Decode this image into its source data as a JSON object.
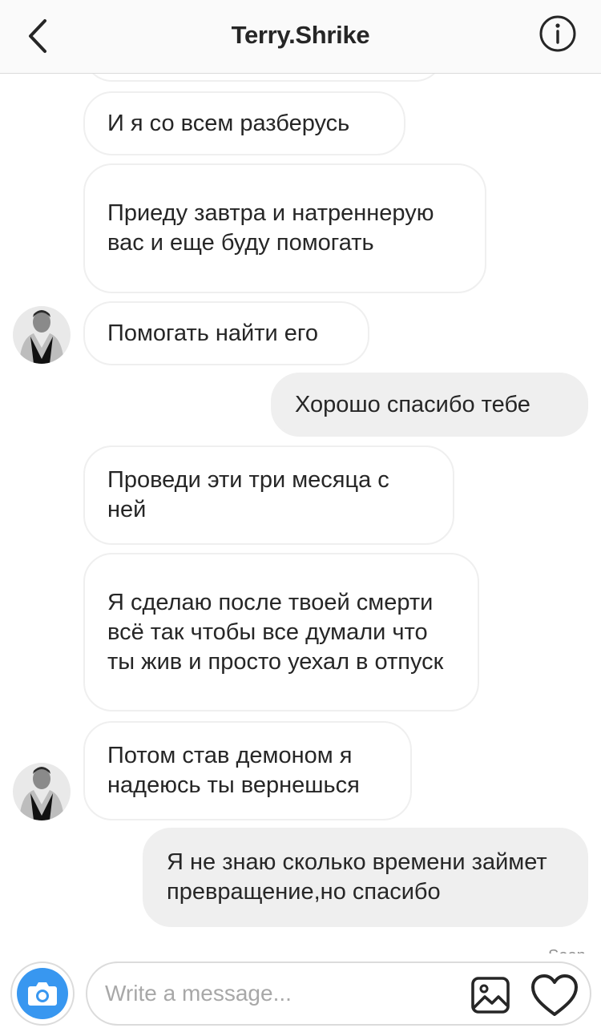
{
  "header": {
    "title": "Terry.Shrike",
    "back_icon": "chevron-left-icon",
    "info_icon": "info-icon"
  },
  "messages": [
    {
      "side": "in",
      "text": "И я со всем разберусь"
    },
    {
      "side": "in",
      "text": "Приеду завтра и натреннерую вас и еще буду помогать"
    },
    {
      "side": "in",
      "text": "Помогать найти его",
      "avatar": true
    },
    {
      "side": "out",
      "text": "Хорошо спасибо тебе"
    },
    {
      "side": "in",
      "text": "Проведи эти три месяца с ней"
    },
    {
      "side": "in",
      "text": "Я сделаю после твоей смерти всё так чтобы все думали что ты жив и просто уехал в отпуск"
    },
    {
      "side": "in",
      "text": "Потом став демоном я надеюсь ты вернешься",
      "avatar": true
    },
    {
      "side": "out",
      "text": "Я не знаю сколько времени займет превращение,но спасибо"
    }
  ],
  "seen_label": "Seen",
  "composer": {
    "placeholder": "Write a message...",
    "value": "",
    "camera_icon": "camera-icon",
    "gallery_icon": "gallery-icon",
    "heart_icon": "heart-icon"
  },
  "colors": {
    "accent": "#3897f0",
    "bubble_out": "#efefef",
    "bubble_in_border": "#efefef",
    "text": "#262626"
  }
}
